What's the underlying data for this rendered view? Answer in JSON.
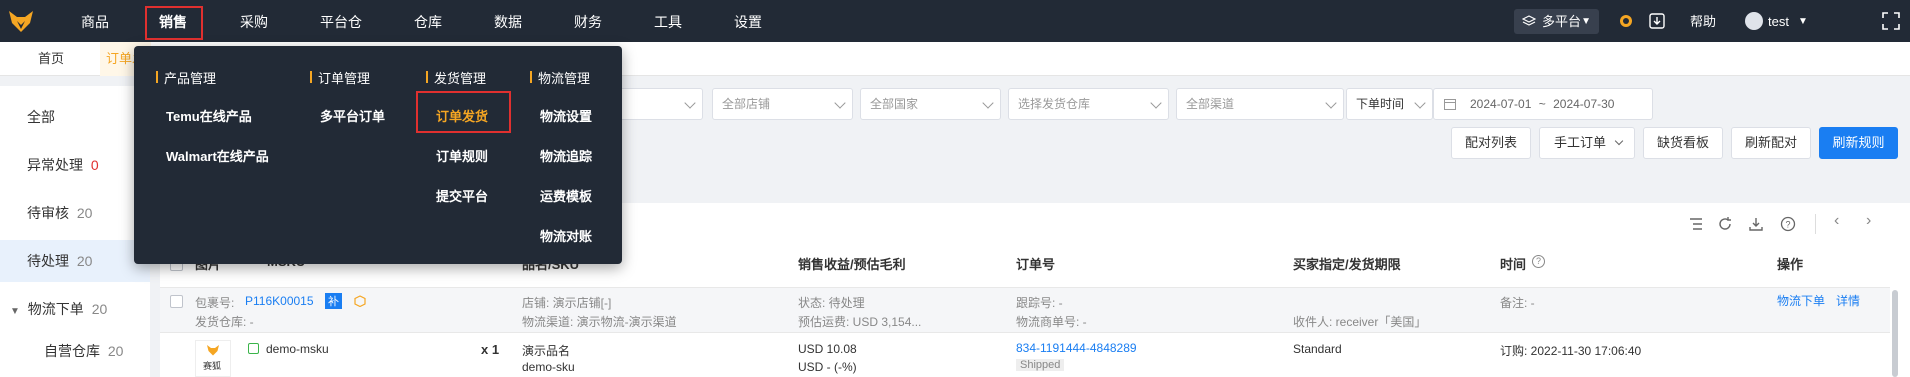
{
  "nav": {
    "items": [
      "商品",
      "销售",
      "采购",
      "平台仓",
      "仓库",
      "数据",
      "财务",
      "工具",
      "设置"
    ],
    "platform_label": "多平台",
    "help_label": "帮助",
    "user_label": "test"
  },
  "tabs": [
    "首页",
    "订单发"
  ],
  "sidebar": {
    "items": [
      {
        "label": "全部",
        "count": ""
      },
      {
        "label": "异常处理",
        "count": "0"
      },
      {
        "label": "待审核",
        "count": "20"
      },
      {
        "label": "待处理",
        "count": "20"
      },
      {
        "label": "物流下单",
        "count": "20"
      },
      {
        "label": "自营仓库",
        "count": "20"
      }
    ]
  },
  "filters": {
    "store_placeholder": "全部店铺",
    "country_placeholder": "全部国家",
    "warehouse_placeholder": "选择发货仓库",
    "channel_placeholder": "全部渠道",
    "time_type": "下单时间",
    "date_start": "2024-07-01",
    "date_sep": "~",
    "date_end": "2024-07-30"
  },
  "actions": {
    "match_list": "配对列表",
    "manual_order": "手工订单",
    "stock_board": "缺货看板",
    "refresh_match": "刷新配对",
    "refresh_rules": "刷新规则"
  },
  "table": {
    "headers": {
      "image": "图片",
      "msku": "MSKU",
      "product": "品名/SKU",
      "revenue": "销售收益/预估毛利",
      "order_no": "订单号",
      "buyer": "买家指定/发货期限",
      "time": "时间",
      "ops": "操作"
    },
    "group": {
      "package_label": "包裹号:",
      "package_no": "P116K00015",
      "supplement_badge": "补",
      "warehouse_label": "发货仓库: -",
      "store_label": "店铺: 演示店铺[-]",
      "channel_label": "物流渠道: 演示物流-演示渠道",
      "status_label": "状态: 待处理",
      "freight_label": "预估运费: USD 3,154...",
      "tracking_label": "跟踪号: -",
      "carrier_no_label": "物流商单号: -",
      "receiver_label": "收件人: receiver「美国」",
      "note_label": "备注: -",
      "op_logistics": "物流下单",
      "op_detail": "详情"
    },
    "row": {
      "logo_text": "赛狐",
      "msku": "demo-msku",
      "qty": "x 1",
      "product_name": "演示品名",
      "sku": "demo-sku",
      "revenue": "USD 10.08",
      "profit": "USD - (-%)",
      "order_no": "834-1191444-4848289",
      "status_badge": "Shipped",
      "buyer_spec": "Standard",
      "order_time": "订购: 2022-11-30 17:06:40"
    }
  },
  "dropdown": {
    "columns": [
      {
        "head": "产品管理",
        "items": [
          "Temu在线产品",
          "Walmart在线产品"
        ]
      },
      {
        "head": "订单管理",
        "items": [
          "多平台订单"
        ]
      },
      {
        "head": "发货管理",
        "items": [
          "订单发货",
          "订单规则",
          "提交平台"
        ]
      },
      {
        "head": "物流管理",
        "items": [
          "物流设置",
          "物流追踪",
          "运费模板",
          "物流对账"
        ]
      }
    ]
  },
  "colors": {
    "topbar": "#222a36",
    "accent": "#1a7ef2",
    "highlight": "#f5a623",
    "danger": "#e0302f"
  }
}
